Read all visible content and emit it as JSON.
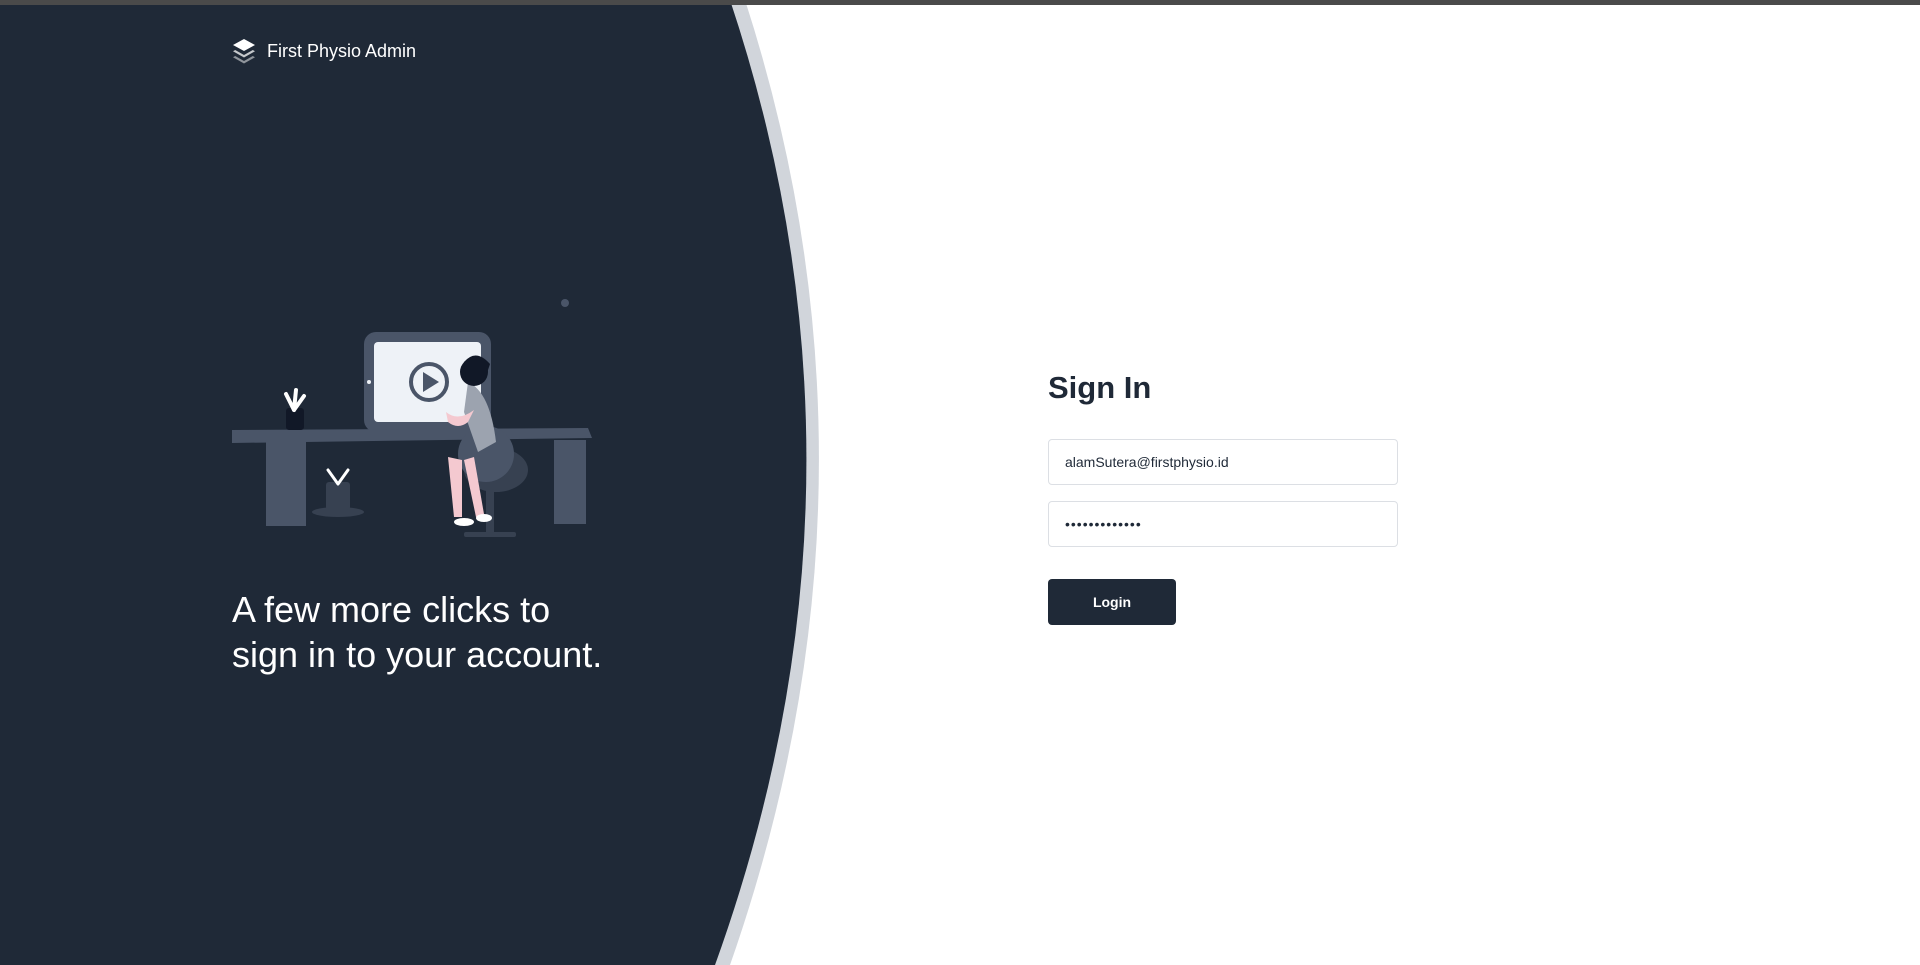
{
  "brand": {
    "name": "First Physio Admin",
    "icon": "layers-icon"
  },
  "hero": {
    "tagline_line1": "A few more clicks to",
    "tagline_line2": "sign in to your account.",
    "illustration": "person-at-desk-watching-video-illustration"
  },
  "form": {
    "title": "Sign In",
    "email_value": "alamSutera@firstphysio.id",
    "password_value": "•••••••••••••",
    "login_label": "Login"
  },
  "colors": {
    "panel": "#1f2937",
    "curve_accent": "#d1d5db",
    "button": "#1f2937",
    "text_dark": "#1f2937",
    "illustration_accent": "#4a5568",
    "illustration_pink": "#f4c9d0"
  }
}
